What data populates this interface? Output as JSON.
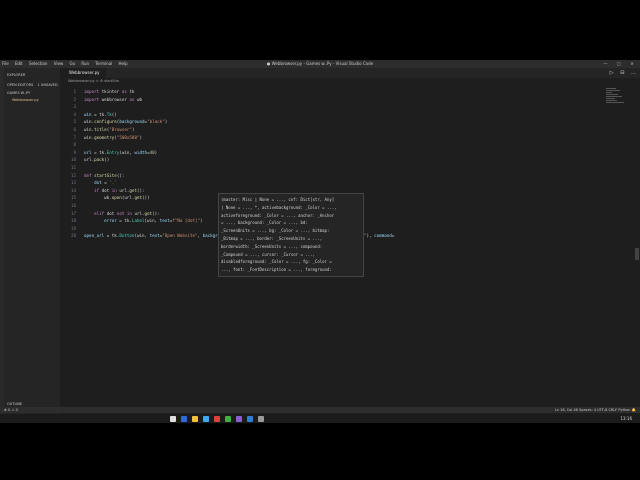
{
  "window": {
    "menus": [
      "File",
      "Edit",
      "Selection",
      "View",
      "Go",
      "Run",
      "Terminal",
      "Help"
    ],
    "title": "● Webbrowser.py - Games w..Py - Visual Studio Code",
    "controls": [
      "—",
      "▢",
      "✕"
    ]
  },
  "sidebar": {
    "explorer_title": "EXPLORER",
    "open_editors_label": "OPEN EDITORS",
    "open_editors_badge": "1 UNSAVED",
    "folder_label": "GAMES W..PY",
    "file_label": "Webbrowser.py",
    "outline_label": "OUTLINE",
    "npm_label": "NPM SCRIPTS"
  },
  "editor": {
    "tab_label": "Webbrowser.py",
    "breadcrumb": "Webbrowser.py > ⚙ startSite",
    "tab_actions": [
      "▷",
      "⊟",
      "…"
    ],
    "lines": [
      {
        "n": "1",
        "html": "<span class=\"kw\">import</span> tkinter <span class=\"kw\">as</span> tk"
      },
      {
        "n": "2",
        "html": "<span class=\"kw\">import</span> webbrowser <span class=\"kw\">as</span> wb"
      },
      {
        "n": "3",
        "html": ""
      },
      {
        "n": "4",
        "html": "<span class=\"var\">win</span> = tk.<span class=\"cls\">Tk</span>()"
      },
      {
        "n": "5",
        "html": "win.<span class=\"fn\">configure</span>(<span class=\"var\">background</span>=<span class=\"str\">\"black\"</span>)"
      },
      {
        "n": "6",
        "html": "win.<span class=\"fn\">title</span>(<span class=\"str\">\"Browser\"</span>)"
      },
      {
        "n": "7",
        "html": "win.<span class=\"fn\">geometry</span>(<span class=\"str\">\"500x500\"</span>)"
      },
      {
        "n": "8",
        "html": ""
      },
      {
        "n": "9",
        "html": "<span class=\"var\">url</span> = tk.<span class=\"cls\">Entry</span>(win, <span class=\"var\">width</span>=<span class=\"num\">40</span>)"
      },
      {
        "n": "10",
        "html": "url.<span class=\"fn\">pack</span>()"
      },
      {
        "n": "11",
        "html": ""
      },
      {
        "n": "12",
        "html": "<span class=\"kw\">def</span> <span class=\"fn\">startSite</span>():"
      },
      {
        "n": "13",
        "html": "    <span class=\"var\">dot</span> = <span class=\"str\">'.'</span>"
      },
      {
        "n": "14",
        "html": "    <span class=\"kw\">if</span> dot <span class=\"kw\">in</span> url.<span class=\"fn\">get</span>():"
      },
      {
        "n": "15",
        "html": "        wb.<span class=\"fn\">open</span>(url.<span class=\"fn\">get</span>())"
      },
      {
        "n": "16",
        "html": ""
      },
      {
        "n": "17",
        "html": "    <span class=\"kw\">elif</span> dot <span class=\"kw\">not in</span> url.<span class=\"fn\">get</span>():"
      },
      {
        "n": "18",
        "html": "        <span class=\"var\">error</span> = tk.<span class=\"cls\">Label</span>(win, <span class=\"var\">text</span>=<span class=\"str\">f\"No [dot]\"</span>)"
      },
      {
        "n": "19",
        "html": ""
      },
      {
        "n": "20",
        "html": "<span class=\"var\">open_url</span> = tk.<span class=\"cls\">Button</span>(win, <span class=\"var\">text</span>=<span class=\"str\">\"Open Website\"</span>, <span class=\"var\">background</span>=<span class=\"str\">\"black\"</span>, <span class=\"var\">foreground</span>=<span class=\"str\">\"white\"</span>, <span class=\"var\">font</span>=(<span class=\"str\">\"arial\"</span>, <span class=\"num\">10</span>, <span class=\"str\">\"bold\"</span>), <span class=\"var\">command</span>="
      }
    ],
    "tooltip_lines": [
      "(master: Misc | None = ..., cnf: Dict[str, Any]",
      "| None = ..., *, activebackground: _Color = ...,",
      "activeforeground: _Color = ..., anchor: _Anchor",
      "= ..., background: _Color = ..., bd:",
      "_ScreenUnits = ..., bg: _Color = ..., bitmap:",
      "_Bitmap = ..., border: _ScreenUnits = ...,",
      "borderwidth: _ScreenUnits = ..., compound:",
      "_Compound = ..., cursor: _Cursor = ...,",
      "disabledforeground: _Color = ..., fg: _Color =",
      "..., font: _FontDescription = ..., foreground:"
    ]
  },
  "statusbar": {
    "left": "⊗ 0 ⚠ 0",
    "right": "Ln 18, Col 46   Spaces: 4   UTF-8   CRLF   Python   🔔"
  },
  "taskbar": {
    "time": "13:16",
    "colors": [
      "#e0e0e0",
      "#2b6cd6",
      "#f0c040",
      "#3ea6ff",
      "#e04040",
      "#40b040",
      "#8a5cd6",
      "#2f7dd6",
      "#999999"
    ]
  }
}
